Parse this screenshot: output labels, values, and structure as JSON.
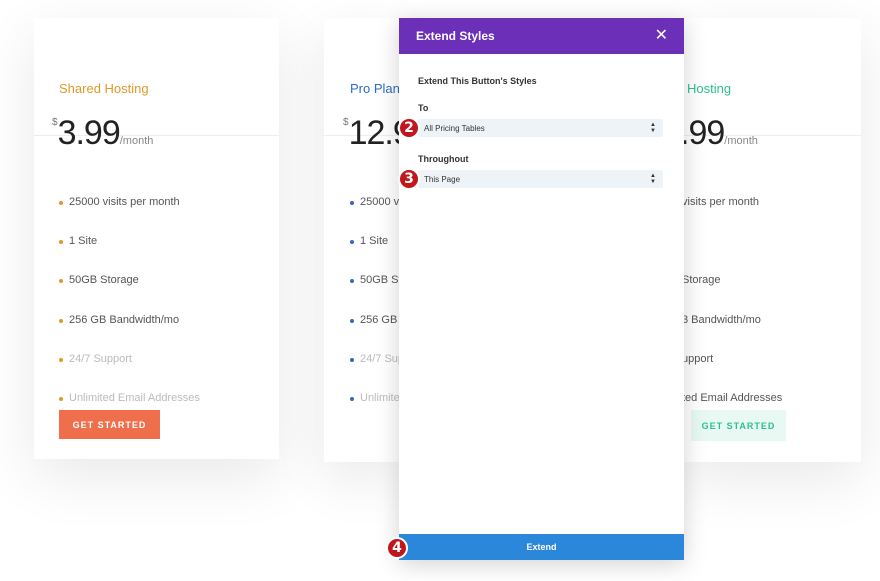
{
  "cards": {
    "shared": {
      "title": "Shared Hosting",
      "currency": "$",
      "amount": "3.99",
      "period": "/month",
      "features": [
        "25000 visits per month",
        "1 Site",
        "50GB Storage",
        "256 GB Bandwidth/mo",
        "24/7 Support",
        "Unlimited Email Addresses"
      ],
      "cta": "GET STARTED",
      "accent": "#e09a2a",
      "button_color": "#ef6f4d"
    },
    "pro": {
      "title": "Pro Plan",
      "currency": "$",
      "amount": "12.9",
      "period": "",
      "features": [
        "25000 vi",
        "1 Site",
        "50GB St",
        "256 GB B",
        "24/7 Sup",
        "Unlimite"
      ],
      "accent": "#2b6cc4"
    },
    "third": {
      "title": "Hosting",
      "amount": ".99",
      "period": "/month",
      "features": [
        "visits per month",
        "",
        "Storage",
        "3 Bandwidth/mo",
        "upport",
        "ted Email Addresses"
      ],
      "cta": "GET STARTED",
      "accent": "#2ebf91",
      "button_bg": "#e8f8f2"
    }
  },
  "modal": {
    "title": "Extend Styles",
    "close_icon": "close-icon",
    "subtitle": "Extend This Button's Styles",
    "to_label": "To",
    "to_value": "All Pricing Tables",
    "throughout_label": "Throughout",
    "throughout_value": "This Page",
    "extend_label": "Extend",
    "header_color": "#6b2fb8",
    "button_color": "#2b87da"
  },
  "steps": [
    "2",
    "3",
    "4"
  ]
}
